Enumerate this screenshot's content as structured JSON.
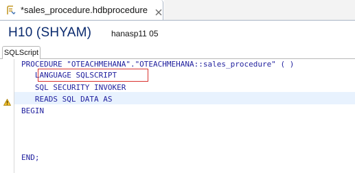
{
  "editor_tab": {
    "title": "*sales_procedure.hdbprocedure",
    "icon": "procedure-file-icon",
    "close_icon": "close-icon"
  },
  "header": {
    "system": "H10 (SHYAM)",
    "host": "hanasp11 05"
  },
  "subtab": {
    "label": "SQLScript"
  },
  "code": {
    "lines": [
      "PROCEDURE \"OTEACHMEHANA\".\"OTEACHMEHANA::sales_procedure\" ( )",
      "   LANGUAGE SQLSCRIPT",
      "   SQL SECURITY INVOKER",
      "   READS SQL DATA AS",
      "BEGIN",
      "",
      "",
      "",
      "END;"
    ]
  },
  "colors": {
    "keyword": "#1f1f9e",
    "system_title": "#0a2a6e",
    "highlight_box": "#d9302c",
    "current_line": "#e8f2fe"
  },
  "annotations": {
    "warning_icon": "warning-icon"
  }
}
